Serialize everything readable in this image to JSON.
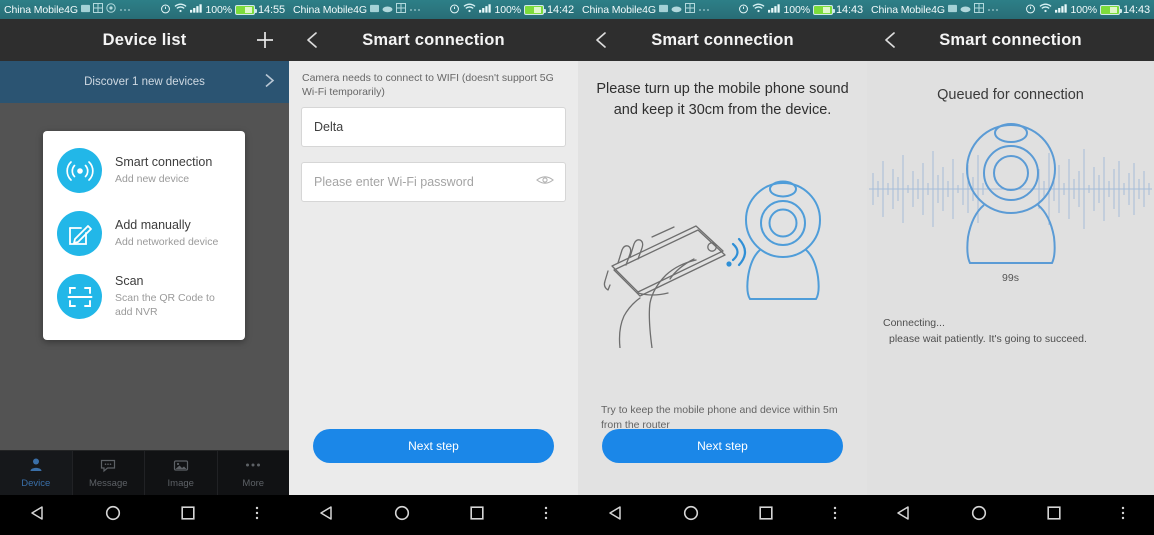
{
  "status_bar": {
    "carrier": "China Mobile4G",
    "battery_percent": "100%",
    "icons": [
      "message-icon",
      "grid-icon",
      "circle-icon",
      "more-dots-icon",
      "alarm-icon",
      "wifi-icon",
      "signal-icon"
    ],
    "times": {
      "p1": "14:55",
      "p2": "14:42",
      "p3": "14:43",
      "p4": "14:43"
    }
  },
  "colors": {
    "status_bar": "#2b757e",
    "app_bar": "#2e2e2e",
    "accent_cyan": "#22b7e8",
    "accent_blue": "#1b87e8",
    "discover_banner": "#2b5472",
    "illustration_blue": "#5b9bd5"
  },
  "panel1": {
    "title": "Device list",
    "add_label": "+",
    "discover_text": "Discover  1  new devices",
    "menu": [
      {
        "title": "Smart connection",
        "subtitle": "Add new device",
        "icon": "wifi-signal-icon"
      },
      {
        "title": "Add manually",
        "subtitle": "Add networked device",
        "icon": "edit-square-icon"
      },
      {
        "title": "Scan",
        "subtitle": "Scan the QR Code to add NVR",
        "icon": "qr-scan-icon"
      }
    ],
    "tabs": [
      {
        "label": "Device",
        "icon": "person-icon",
        "active": true
      },
      {
        "label": "Message",
        "icon": "chat-bubble-icon",
        "active": false
      },
      {
        "label": "Image",
        "icon": "photo-icon",
        "active": false
      },
      {
        "label": "More",
        "icon": "more-dots-icon",
        "active": false
      }
    ]
  },
  "panel2": {
    "title": "Smart connection",
    "hint": "Camera needs to connect to WIFI (doesn't support 5G Wi-Fi temporarily)",
    "ssid_value": "Delta",
    "password_placeholder": "Please enter Wi-Fi password",
    "password_value": "",
    "eye_icon": "eye-icon",
    "next_label": "Next step"
  },
  "panel3": {
    "title": "Smart connection",
    "instruction": "Please turn up the mobile phone sound and keep it 30cm from the device.",
    "footer": "Try to keep the mobile phone and device within 5m from the router",
    "next_label": "Next step",
    "illustration": "hand-holding-phone-and-camera-icon"
  },
  "panel4": {
    "title": "Smart connection",
    "heading": "Queued for connection",
    "timer": "99s",
    "status_line1": "Connecting...",
    "status_line2": "please wait patiently. It's going to succeed.",
    "illustration": "camera-with-waveform-icon"
  },
  "navbar": {
    "back": "back-triangle-icon",
    "home": "home-circle-icon",
    "recents": "recents-square-icon",
    "menu": "menu-dots-icon"
  }
}
